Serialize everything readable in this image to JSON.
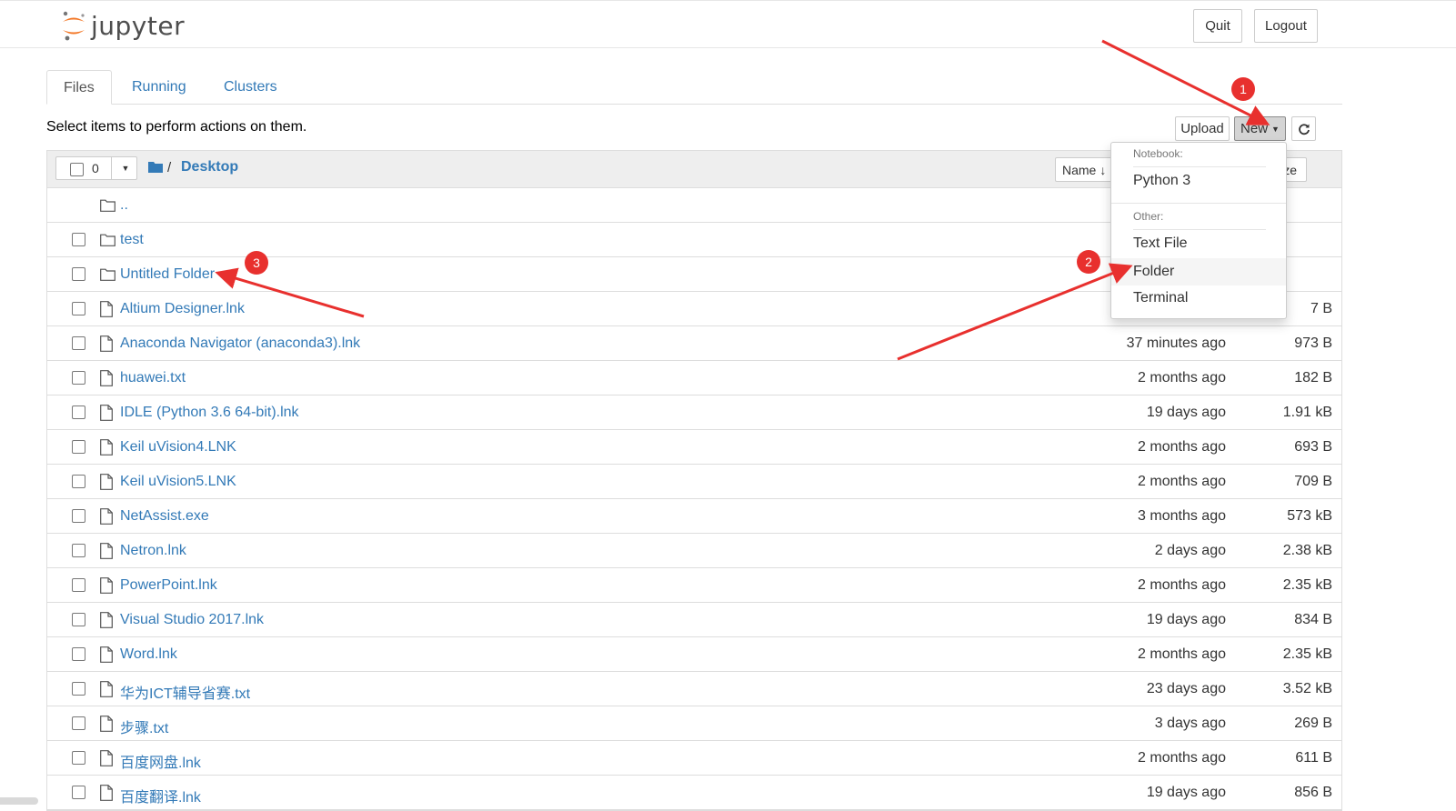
{
  "header": {
    "logo_text": "jupyter",
    "quit_label": "Quit",
    "logout_label": "Logout"
  },
  "tabs": [
    {
      "label": "Files",
      "active": true
    },
    {
      "label": "Running",
      "active": false
    },
    {
      "label": "Clusters",
      "active": false
    }
  ],
  "toolbar": {
    "hint": "Select items to perform actions on them.",
    "upload_label": "Upload",
    "new_label": "New",
    "selected_count": "0"
  },
  "list_header": {
    "path_separator": "/",
    "current_folder": "Desktop",
    "sort_name_label": "Name",
    "sort_size_partial": "ze"
  },
  "rows": [
    {
      "name": "..",
      "type": "folder",
      "modified": "",
      "size": ""
    },
    {
      "name": "test",
      "type": "folder",
      "modified": "",
      "size": ""
    },
    {
      "name": "Untitled Folder",
      "type": "folder",
      "modified": "",
      "size": ""
    },
    {
      "name": "Altium Designer.lnk",
      "type": "file",
      "modified": "",
      "size": "7 B"
    },
    {
      "name": "Anaconda Navigator (anaconda3).lnk",
      "type": "file",
      "modified": "37 minutes ago",
      "size": "973 B"
    },
    {
      "name": "huawei.txt",
      "type": "file",
      "modified": "2 months ago",
      "size": "182 B"
    },
    {
      "name": "IDLE (Python 3.6 64-bit).lnk",
      "type": "file",
      "modified": "19 days ago",
      "size": "1.91 kB"
    },
    {
      "name": "Keil uVision4.LNK",
      "type": "file",
      "modified": "2 months ago",
      "size": "693 B"
    },
    {
      "name": "Keil uVision5.LNK",
      "type": "file",
      "modified": "2 months ago",
      "size": "709 B"
    },
    {
      "name": "NetAssist.exe",
      "type": "file",
      "modified": "3 months ago",
      "size": "573 kB"
    },
    {
      "name": "Netron.lnk",
      "type": "file",
      "modified": "2 days ago",
      "size": "2.38 kB"
    },
    {
      "name": "PowerPoint.lnk",
      "type": "file",
      "modified": "2 months ago",
      "size": "2.35 kB"
    },
    {
      "name": "Visual Studio 2017.lnk",
      "type": "file",
      "modified": "19 days ago",
      "size": "834 B"
    },
    {
      "name": "Word.lnk",
      "type": "file",
      "modified": "2 months ago",
      "size": "2.35 kB"
    },
    {
      "name": "华为ICT辅导省赛.txt",
      "type": "file",
      "modified": "23 days ago",
      "size": "3.52 kB"
    },
    {
      "name": "步骤.txt",
      "type": "file",
      "modified": "3 days ago",
      "size": "269 B"
    },
    {
      "name": "百度网盘.lnk",
      "type": "file",
      "modified": "2 months ago",
      "size": "611 B"
    },
    {
      "name": "百度翻译.lnk",
      "type": "file",
      "modified": "19 days ago",
      "size": "856 B"
    }
  ],
  "new_menu": {
    "notebook_header": "Notebook:",
    "python_label": "Python 3",
    "other_header": "Other:",
    "text_file_label": "Text File",
    "folder_label": "Folder",
    "terminal_label": "Terminal"
  },
  "annotations": {
    "badge_1": "1",
    "badge_2": "2",
    "badge_3": "3",
    "arrow_color": "#e8302e"
  },
  "colors": {
    "link": "#337ab7",
    "header_bg": "#eeeeee",
    "logo_orange": "#f37726"
  }
}
